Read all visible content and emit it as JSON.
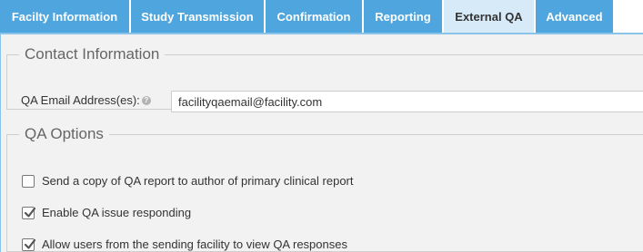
{
  "tabs": [
    {
      "label": "Facilty Information",
      "active": false
    },
    {
      "label": "Study Transmission",
      "active": false
    },
    {
      "label": "Confirmation",
      "active": false
    },
    {
      "label": "Reporting",
      "active": false
    },
    {
      "label": "External QA",
      "active": true
    },
    {
      "label": "Advanced",
      "active": false
    }
  ],
  "contact": {
    "legend": "Contact Information",
    "email_label": "QA Email Address(es):",
    "help_icon": "help-icon",
    "email_value": "facilityqaemail@facility.com"
  },
  "qa_options": {
    "legend": "QA Options",
    "options": [
      {
        "label": "Send a copy of QA report to author of primary clinical report",
        "checked": false
      },
      {
        "label": "Enable QA issue responding",
        "checked": true
      },
      {
        "label": "Allow users from the sending facility to view QA responses",
        "checked": true
      }
    ]
  },
  "colors": {
    "tab_bg": "#4fa6df",
    "tab_active_bg": "#d6eaf8",
    "panel_bg": "#f2f2f2"
  }
}
